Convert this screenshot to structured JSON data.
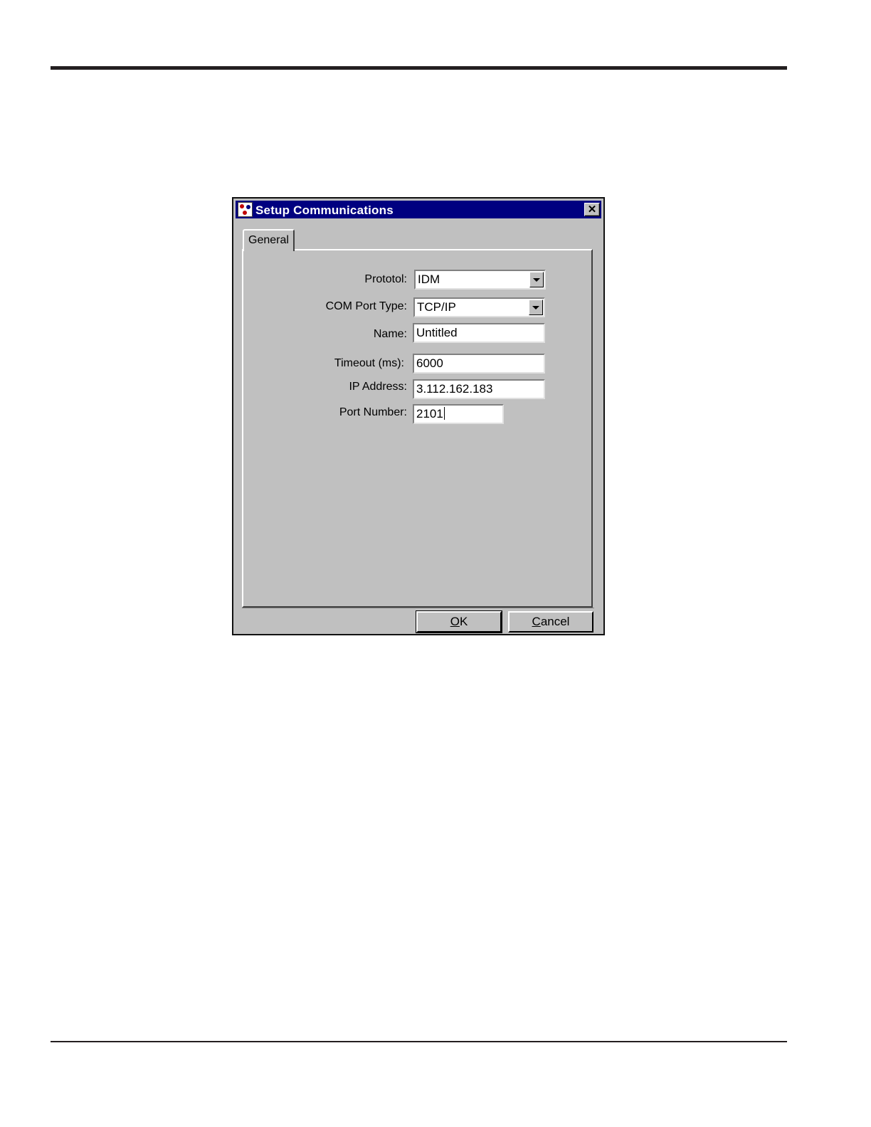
{
  "dialog": {
    "title": "Setup Communications",
    "icon": "com-setup-icon",
    "close_glyph": "✕"
  },
  "tabs": [
    {
      "label": "General",
      "selected": true
    }
  ],
  "form": {
    "protocol_label": "Prototol:",
    "protocol_value": "IDM",
    "com_port_type_label": "COM Port Type:",
    "com_port_type_value": "TCP/IP",
    "name_label": "Name:",
    "name_value": "Untitled",
    "timeout_label": "Timeout (ms):",
    "timeout_value": "6000",
    "ip_address_label": "IP Address:",
    "ip_address_value": "3.112.162.183",
    "port_number_label": "Port Number:",
    "port_number_value": "2101"
  },
  "buttons": {
    "ok_mnemonic": "O",
    "ok_rest": "K",
    "cancel_mnemonic": "C",
    "cancel_rest": "ancel"
  },
  "colors": {
    "titlebar": "#000080",
    "face": "#c0c0c0"
  }
}
